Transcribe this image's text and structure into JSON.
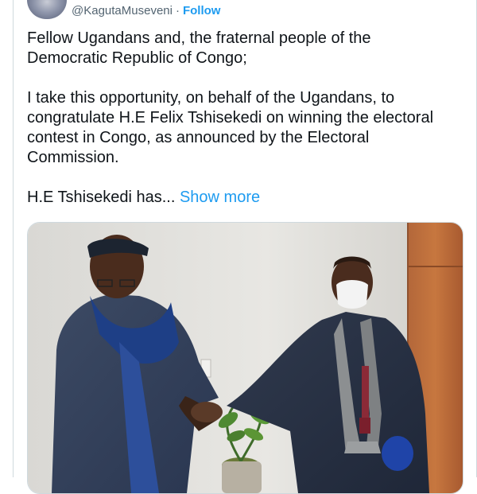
{
  "header": {
    "handle": "@KagutaMuseveni",
    "separator": "·",
    "follow_label": "Follow"
  },
  "tweet": {
    "paragraph1": "Fellow Ugandans and, the fraternal people of the\nDemocratic Republic of Congo;",
    "paragraph2": "I take this opportunity, on behalf of the Ugandans, to\ncongratulate H.E Felix Tshisekedi on winning the electoral\ncontest in Congo, as announced by the Electoral\nCommission.",
    "paragraph3_prefix": "H.E Tshisekedi has... ",
    "show_more_label": "Show more"
  },
  "colors": {
    "link": "#1d9bf0",
    "text": "#0f1419",
    "muted": "#536471",
    "border": "#cfd9de"
  }
}
